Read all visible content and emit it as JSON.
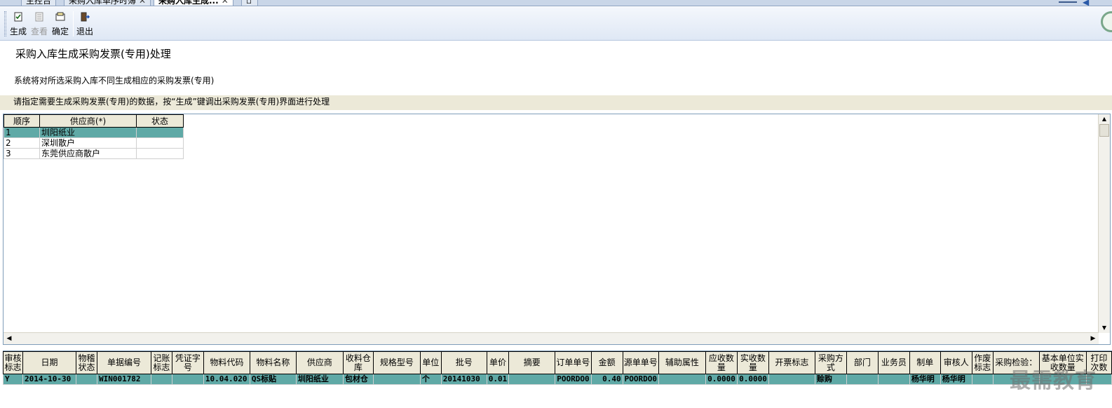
{
  "tabs": [
    {
      "label": "主控台",
      "closable": false
    },
    {
      "label": "采购入库单序时簿",
      "closable": true
    },
    {
      "label": "采购入库生成...",
      "closable": true
    }
  ],
  "toolbar": {
    "buttons": [
      {
        "label": "生成",
        "icon": "generate-icon",
        "enabled": true
      },
      {
        "label": "查看",
        "icon": "view-icon",
        "enabled": false
      },
      {
        "label": "确定",
        "icon": "confirm-icon",
        "enabled": true
      },
      {
        "label": "退出",
        "icon": "exit-icon",
        "enabled": true
      }
    ]
  },
  "page": {
    "title": "采购入库生成采购发票(专用)处理",
    "description": "系统将对所选采购入库不同生成相应的采购发票(专用)",
    "instruction": "请指定需要生成采购发票(专用)的数据，按“生成”键调出采购发票(专用)界面进行处理"
  },
  "supplier_grid": {
    "columns": [
      "顺序",
      "供应商(*)",
      "状态"
    ],
    "rows": [
      {
        "seq": "1",
        "supplier": "圳阳纸业",
        "status": "",
        "selected": true
      },
      {
        "seq": "2",
        "supplier": "深圳散户",
        "status": "",
        "selected": false
      },
      {
        "seq": "3",
        "supplier": "东莞供应商散户",
        "status": "",
        "selected": false
      }
    ]
  },
  "detail_grid": {
    "columns": [
      "审核标志",
      "日期",
      "物稽状态",
      "单据编号",
      "记账标志",
      "凭证字号",
      "物料代码",
      "物料名称",
      "供应商",
      "收料仓库",
      "规格型号",
      "单位",
      "批号",
      "单价",
      "摘要",
      "订单单号",
      "金额",
      "源单单号",
      "辅助属性",
      "应收数量",
      "实收数量",
      "开票标志",
      "采购方式",
      "部门",
      "业务员",
      "制单",
      "审核人",
      "作废标志",
      "采购检验：",
      "基本单位实收数量",
      "打印次数"
    ],
    "rows": [
      [
        "Y",
        "2014-10-30",
        "",
        "WIN001782",
        "",
        "",
        "10.04.020",
        "QS标贴",
        "圳阳纸业",
        "包材仓",
        "",
        "个",
        "20141030",
        "0.01",
        "",
        "POORDO0",
        "0.40",
        "POORDO0",
        "",
        "0.0000",
        "0.0000",
        "",
        "赊购",
        "",
        "",
        "杨华明",
        "杨华明",
        "",
        "",
        "",
        ""
      ]
    ]
  },
  "watermark": "最需教育"
}
